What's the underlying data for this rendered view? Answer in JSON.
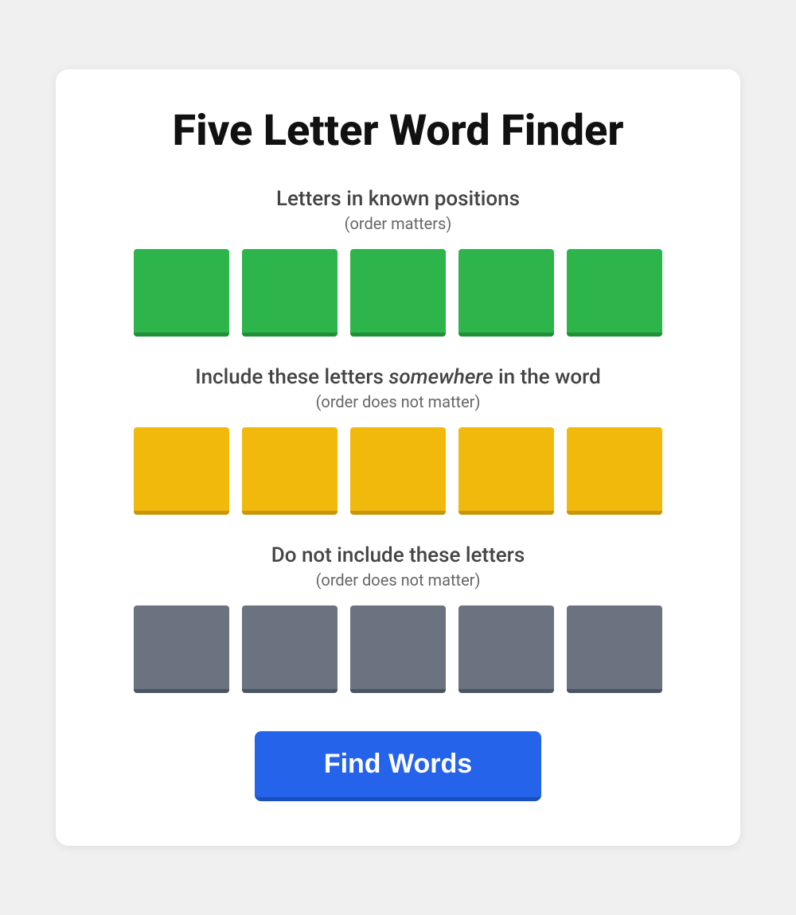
{
  "page": {
    "title": "Five Letter Word Finder"
  },
  "sections": {
    "known": {
      "title": "Letters in known positions",
      "subtitle": "(order matters)",
      "tiles": [
        {
          "value": "",
          "color": "green"
        },
        {
          "value": "",
          "color": "green"
        },
        {
          "value": "",
          "color": "green"
        },
        {
          "value": "",
          "color": "green"
        },
        {
          "value": "",
          "color": "green"
        }
      ]
    },
    "somewhere": {
      "title_prefix": "Include these letters ",
      "title_emphasis": "somewhere",
      "title_suffix": " in the word",
      "subtitle": "(order does not matter)",
      "tiles": [
        {
          "value": "",
          "color": "yellow"
        },
        {
          "value": "",
          "color": "yellow"
        },
        {
          "value": "",
          "color": "yellow"
        },
        {
          "value": "",
          "color": "yellow"
        },
        {
          "value": "",
          "color": "yellow"
        }
      ]
    },
    "exclude": {
      "title": "Do not include these letters",
      "subtitle": "(order does not matter)",
      "tiles": [
        {
          "value": "",
          "color": "gray"
        },
        {
          "value": "",
          "color": "gray"
        },
        {
          "value": "",
          "color": "gray"
        },
        {
          "value": "",
          "color": "gray"
        },
        {
          "value": "",
          "color": "gray"
        }
      ]
    }
  },
  "button": {
    "label": "Find Words"
  }
}
